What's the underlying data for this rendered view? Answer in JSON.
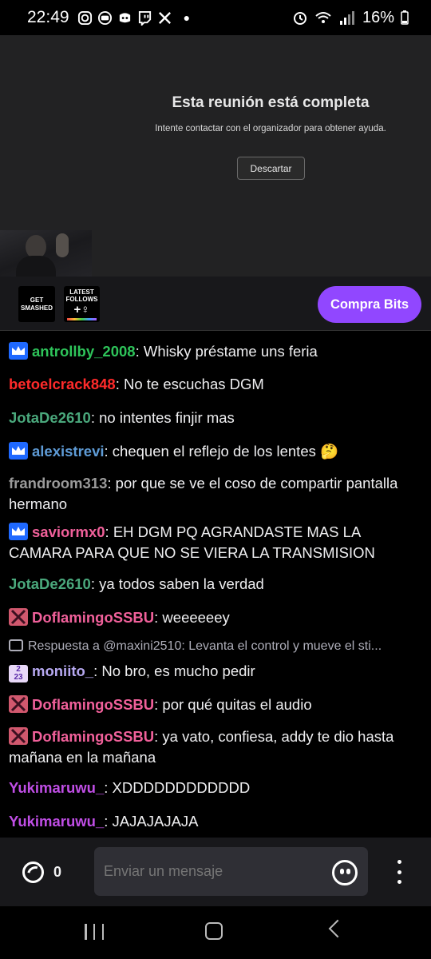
{
  "status_bar": {
    "time": "22:49",
    "battery": "16%",
    "app_icons": [
      "instagram-icon",
      "youtube-icon",
      "discord-icon",
      "twitch-icon",
      "x-icon"
    ]
  },
  "video": {
    "title": "Esta reunión está completa",
    "subtitle": "Intente contactar con el organizador para obtener ayuda.",
    "dismiss_label": "Descartar"
  },
  "extensions": {
    "ext1_label_top": "GET",
    "ext1_label_bottom": "SMASHED",
    "ext2_label": "LATEST FOLLOWS",
    "ext2_sub": "+♀",
    "bits_label": "Compra Bits"
  },
  "colors": {
    "accent": "#9147ff",
    "green_user": "#2ec45a",
    "red_user": "#ff2a2a",
    "teal_user": "#4aa87c",
    "blue_user": "#5e9bd6",
    "gray_user": "#9a9a9a",
    "pink_user": "#f0609a",
    "violet_user": "#c04ee6",
    "lavender_user": "#b6a8f0"
  },
  "chat": {
    "messages": [
      {
        "user": "antrollby_2008",
        "text": ": Whisky préstame uns feria",
        "badge": "crown"
      },
      {
        "user": "betoelcrack848",
        "text": ": No te escuchas DGM",
        "badge": ""
      },
      {
        "user": "JotaDe2610",
        "text": ": no intentes finjir mas",
        "badge": ""
      },
      {
        "user": "alexistrevi",
        "text": ": chequen el reflejo de los lentes 🤔",
        "badge": "crown"
      },
      {
        "user": "frandroom313",
        "text": ": por que se ve el coso de compartir pantalla hermano",
        "badge": ""
      },
      {
        "user": "saviormx0",
        "text": ": EH DGM PQ AGRANDASTE MAS LA CAMARA PARA QUE NO SE VIERA LA TRANSMISION",
        "badge": "crown"
      },
      {
        "user": "JotaDe2610",
        "text": ": ya todos saben la verdad",
        "badge": ""
      },
      {
        "user": "DoflamingoSSBU",
        "text": ": weeeeeey",
        "badge": "x"
      },
      {
        "user": "moniito_",
        "text": ": No bro, es mucho pedir",
        "badge": "sub23"
      },
      {
        "user": "DoflamingoSSBU",
        "text": ": por qué quitas el audio",
        "badge": "x"
      },
      {
        "user": "DoflamingoSSBU",
        "text": ": ya vato, confiesa, addy te dio hasta mañana en la mañana",
        "badge": "x"
      },
      {
        "user": "Yukimaruwu_",
        "text": ": XDDDDDDDDDDDD",
        "badge": ""
      },
      {
        "user": "Yukimaruwu_",
        "text": ": JAJAJAJAJA",
        "badge": ""
      }
    ],
    "reply_text": "Respuesta a @maxini2510: Levanta el control y mueve el sti...",
    "badge_sub_text_top": "2",
    "badge_sub_text_bottom": "23"
  },
  "input": {
    "points_value": "0",
    "placeholder": "Enviar un mensaje"
  }
}
